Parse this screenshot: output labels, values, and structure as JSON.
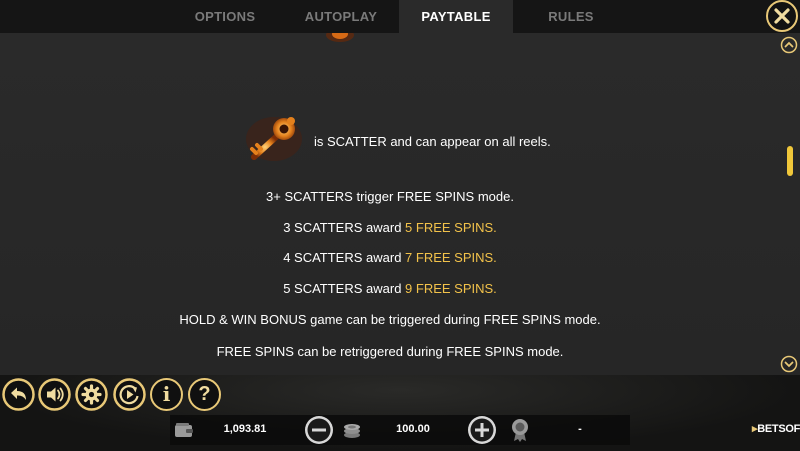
{
  "tabs": {
    "options": "OPTIONS",
    "autoplay": "AUTOPLAY",
    "paytable": "PAYTABLE",
    "rules": "RULES",
    "active": "paytable"
  },
  "paytable": {
    "scatter_description": "is SCATTER and can appear on all reels.",
    "trigger_line": "3+ SCATTERS trigger FREE SPINS mode.",
    "awards": [
      {
        "prefix": "3 SCATTERS award ",
        "highlight": "5 FREE SPINS."
      },
      {
        "prefix": "4 SCATTERS award ",
        "highlight": "7 FREE SPINS."
      },
      {
        "prefix": "5 SCATTERS award ",
        "highlight": "9 FREE SPINS."
      }
    ],
    "hold_win_line": "HOLD & WIN BONUS game can be triggered during FREE SPINS mode.",
    "retrigger_line": "FREE SPINS can be retriggered during FREE SPINS mode."
  },
  "scroll": {
    "position_fraction": 0.35
  },
  "bottom": {
    "balance": "1,093.81",
    "bet": "100.00",
    "win": "-",
    "info_label": "i",
    "help_label": "?"
  },
  "brand": {
    "prefix": "▸",
    "name": "BETSOFT"
  },
  "colors": {
    "accent": "#f2c24a",
    "button_ring": "#e8c877",
    "panel": "#2a2a2a"
  },
  "icons": [
    "close-icon",
    "scroll-up-icon",
    "scroll-down-icon",
    "key-scatter-icon",
    "back-icon",
    "sound-icon",
    "settings-icon",
    "autoplay-icon",
    "info-icon",
    "help-icon",
    "wallet-icon",
    "minus-icon",
    "coins-icon",
    "plus-icon",
    "medal-icon"
  ]
}
